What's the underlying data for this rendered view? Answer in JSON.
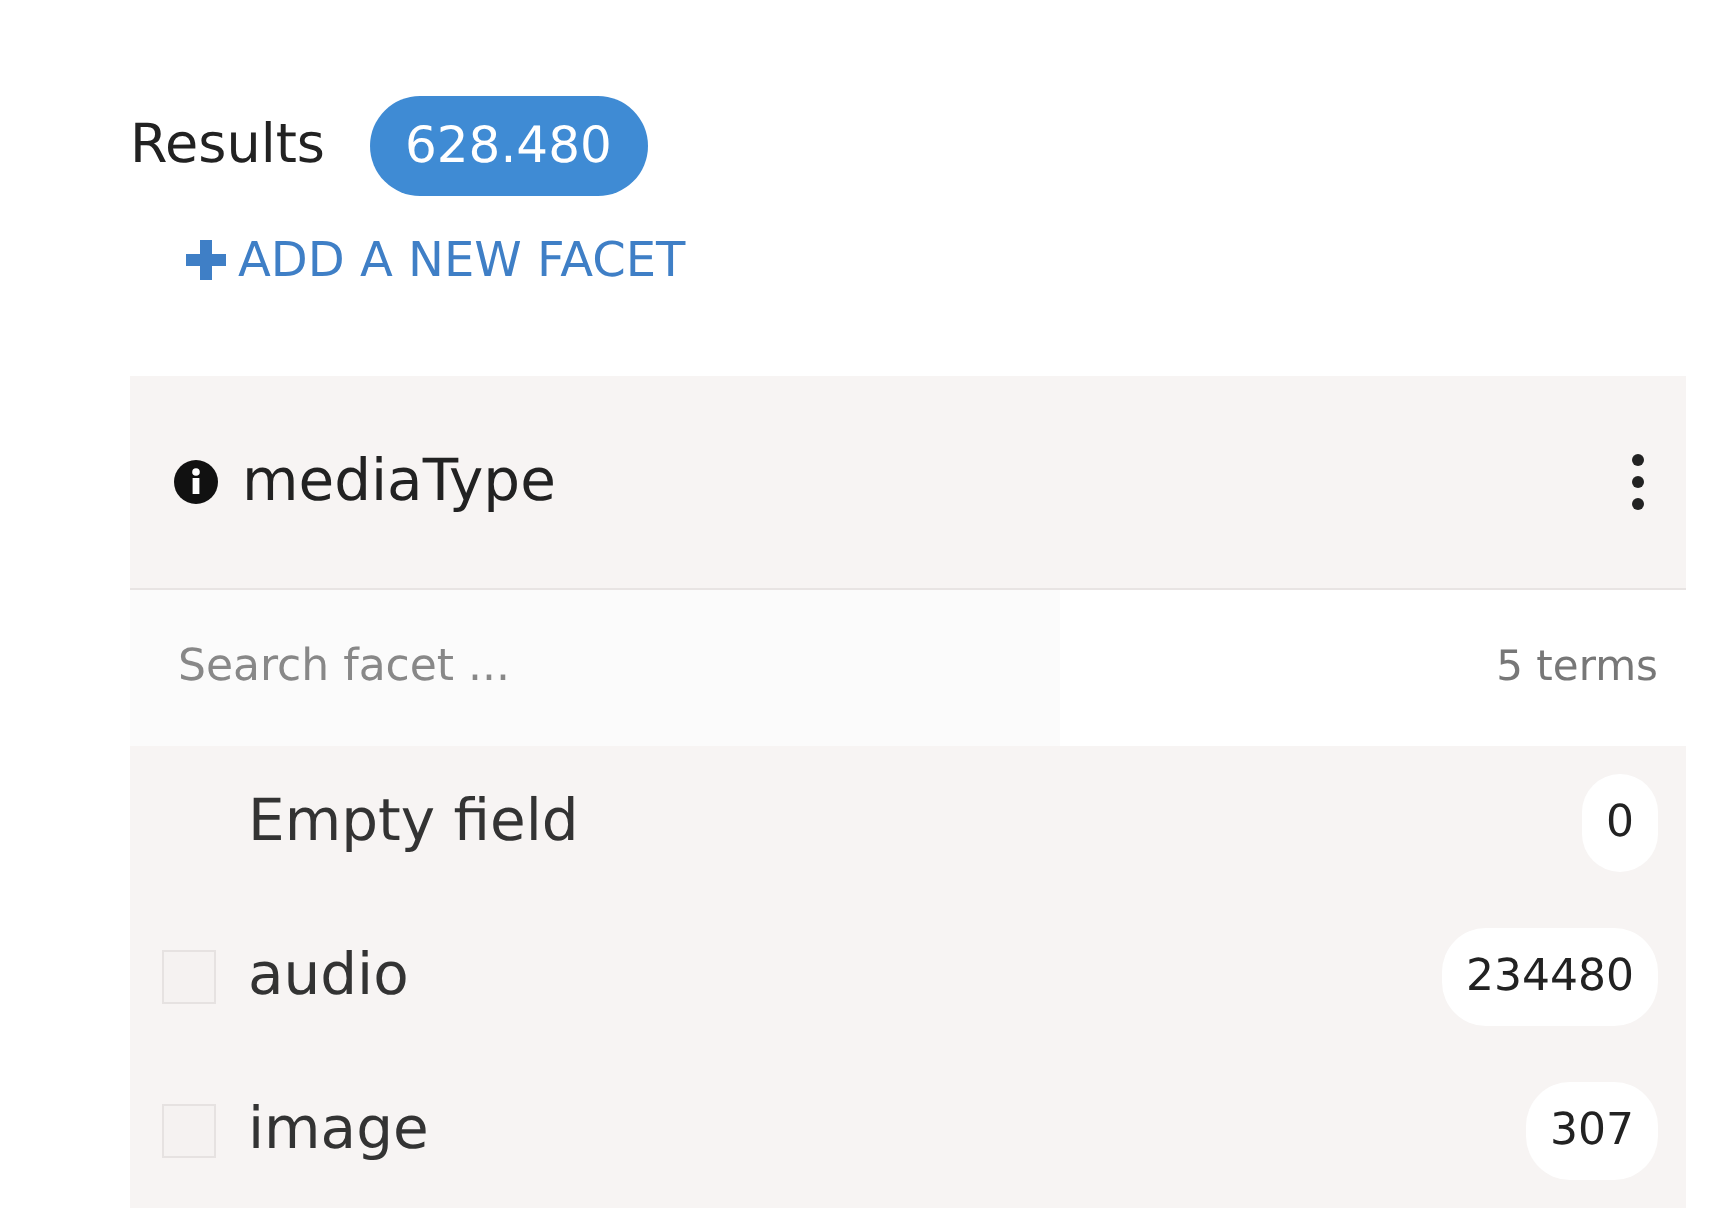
{
  "results": {
    "label": "Results",
    "count": "628.480"
  },
  "add_facet": {
    "label": "ADD A NEW FACET"
  },
  "facet": {
    "title": "mediaType",
    "search": {
      "placeholder": "Search facet ..."
    },
    "terms": "5 terms",
    "items": [
      {
        "kind": "empty",
        "label": "Empty field",
        "count": "0"
      },
      {
        "kind": "checkbox",
        "label": "audio",
        "count": "234480",
        "checked": false
      },
      {
        "kind": "checkbox",
        "label": "image",
        "count": "307",
        "checked": false
      }
    ]
  }
}
